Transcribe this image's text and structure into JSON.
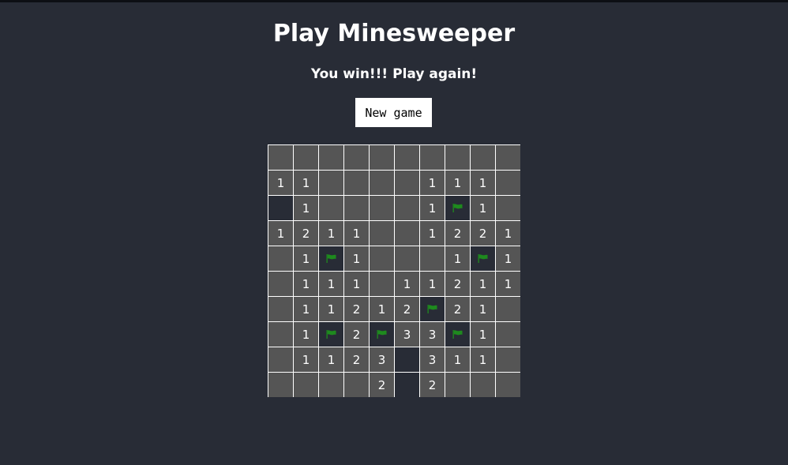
{
  "title": "Play Minesweeper",
  "status": "You win!!! Play again!",
  "new_game_label": "New game",
  "colors": {
    "background": "#282c36",
    "cell_revealed": "#555555",
    "cell_hidden": "#282c36",
    "grid_lines": "#ffffff",
    "flag": "#1e8a1e"
  },
  "legend": {
    "F": "flag",
    "H": "unrevealed",
    "empty": "revealed blank"
  },
  "board": [
    [
      "",
      "",
      "",
      "",
      "",
      "",
      "",
      "",
      "",
      ""
    ],
    [
      "1",
      "1",
      "",
      "",
      "",
      "",
      "1",
      "1",
      "1",
      ""
    ],
    [
      "H",
      "1",
      "",
      "",
      "",
      "",
      "1",
      "F",
      "1",
      ""
    ],
    [
      "1",
      "2",
      "1",
      "1",
      "",
      "",
      "1",
      "2",
      "2",
      "1"
    ],
    [
      "",
      "1",
      "F",
      "1",
      "",
      "",
      "",
      "1",
      "F",
      "1"
    ],
    [
      "",
      "1",
      "1",
      "1",
      "",
      "1",
      "1",
      "2",
      "1",
      "1"
    ],
    [
      "",
      "1",
      "1",
      "2",
      "1",
      "2",
      "F",
      "2",
      "1",
      ""
    ],
    [
      "",
      "1",
      "F",
      "2",
      "F",
      "3",
      "3",
      "F",
      "1",
      ""
    ],
    [
      "",
      "1",
      "1",
      "2",
      "3",
      "H",
      "3",
      "1",
      "1",
      ""
    ],
    [
      "",
      "",
      "",
      "",
      "2",
      "H",
      "2",
      "",
      "",
      ""
    ]
  ]
}
